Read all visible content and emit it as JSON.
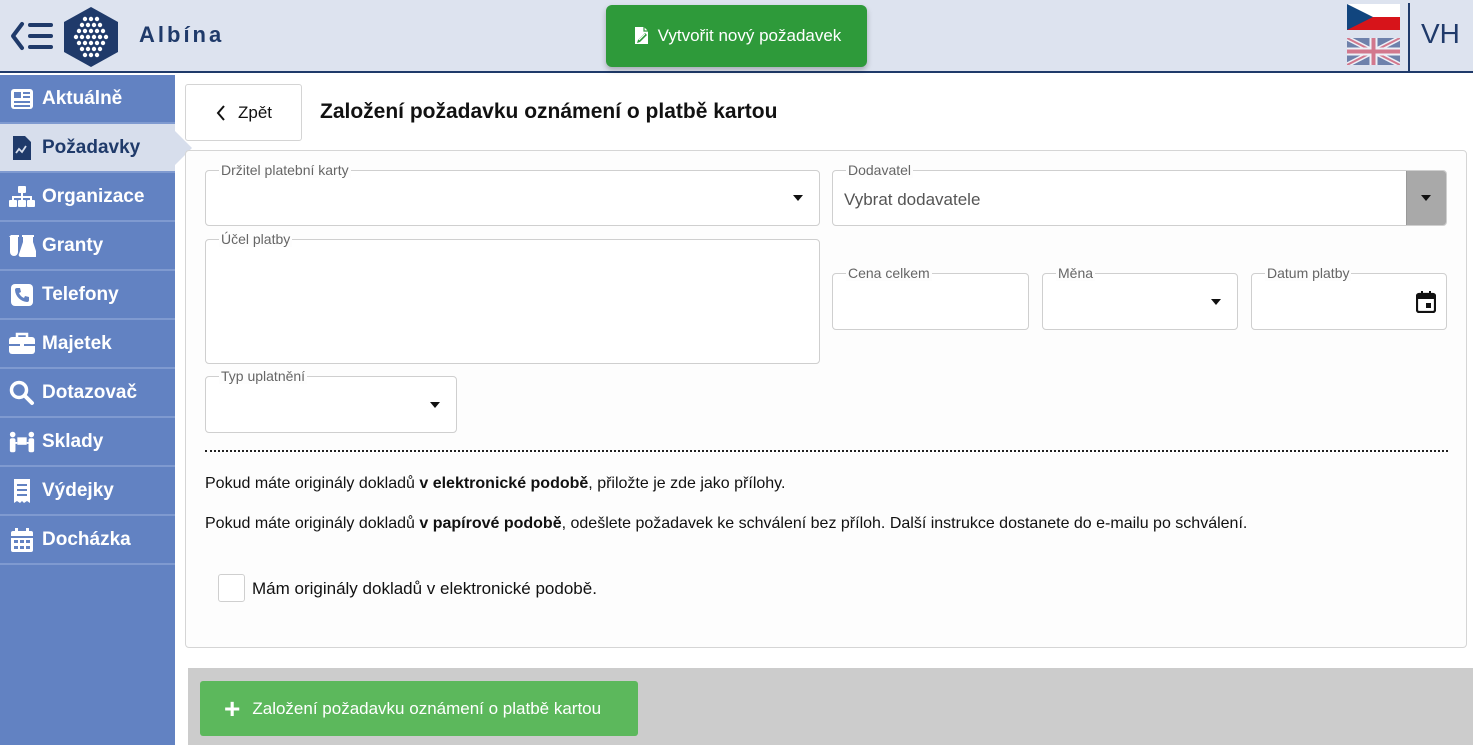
{
  "app": {
    "brand": "Albína",
    "user_initials": "VH"
  },
  "header": {
    "new_request_label": "Vytvořit nový požadavek"
  },
  "sidebar": {
    "items": [
      {
        "label": "Aktuálně",
        "icon": "newspaper-icon"
      },
      {
        "label": "Požadavky",
        "icon": "file-chart-icon",
        "active": true
      },
      {
        "label": "Organizace",
        "icon": "sitemap-icon"
      },
      {
        "label": "Granty",
        "icon": "flask-icon"
      },
      {
        "label": "Telefony",
        "icon": "phone-icon"
      },
      {
        "label": "Majetek",
        "icon": "briefcase-icon"
      },
      {
        "label": "Dotazovač",
        "icon": "search-icon"
      },
      {
        "label": "Sklady",
        "icon": "people-carry-icon"
      },
      {
        "label": "Výdejky",
        "icon": "receipt-icon"
      },
      {
        "label": "Docházka",
        "icon": "calendar-icon"
      }
    ]
  },
  "page": {
    "back_label": "Zpět",
    "title": "Založení požadavku oznámení o platbě kartou"
  },
  "form": {
    "card_holder_label": "Držitel platební karty",
    "card_holder_value": "",
    "supplier_label": "Dodavatel",
    "supplier_placeholder": "Vybrat dodavatele",
    "purpose_label": "Účel platby",
    "purpose_value": "",
    "total_price_label": "Cena celkem",
    "total_price_value": "",
    "currency_label": "Měna",
    "currency_value": "",
    "payment_date_label": "Datum platby",
    "payment_date_value": "",
    "application_type_label": "Typ uplatnění",
    "application_type_value": ""
  },
  "info": {
    "line1_pre": "Pokud máte originály dokladů ",
    "line1_bold": "v elektronické podobě",
    "line1_post": ", přiložte je zde jako přílohy.",
    "line2_pre": "Pokud máte originály dokladů ",
    "line2_bold": "v papírové podobě",
    "line2_post": ", odešlete požadavek ke schválení bez příloh. Další instrukce dostanete do e-mailu po schválení."
  },
  "checkbox": {
    "label": "Mám originály dokladů v elektronické podobě.",
    "checked": false
  },
  "footer": {
    "submit_label": "Založení požadavku oznámení o platbě kartou"
  },
  "colors": {
    "header_bg": "#dde3ef",
    "brand_navy": "#1f3a6a",
    "sidebar_bg": "#6282c2",
    "sidebar_active_bg": "#d7deec",
    "new_request_green": "#2e9a3a",
    "submit_green": "#5cb85c",
    "footer_bar": "#cccccc"
  }
}
